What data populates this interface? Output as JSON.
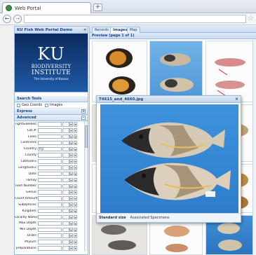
{
  "browser": {
    "tab_title": "Web Portal",
    "new_tab_label": "+",
    "back_label": "←",
    "forward_label": "→",
    "star_label": "☆"
  },
  "left_panel": {
    "title": "KU Fish Web Portal Demo",
    "collapse_label": "«",
    "logo": {
      "letters": "KU",
      "line1": "BIODIVERSITY",
      "line2": "INSTITUTE",
      "line3": "The University of Kansas"
    },
    "search_tools": {
      "title": "Search Tools",
      "geo_coords_label": "Geo Coords",
      "images_label": "Images"
    },
    "express": {
      "title": "Express",
      "toggle": "+"
    },
    "advanced": {
      "title": "Advanced",
      "toggle": "–"
    },
    "fields": [
      {
        "label": "rightSideRels:",
        "value": ""
      },
      {
        "label": "Cat #:",
        "value": ""
      },
      {
        "label": "Class:",
        "value": ""
      },
      {
        "label": "Continent:",
        "value": ""
      },
      {
        "label": "Country:",
        "value": "Fiji"
      },
      {
        "label": "County:",
        "value": ""
      },
      {
        "label": "Latitude1:",
        "value": ""
      },
      {
        "label": "Longitude1:",
        "value": ""
      },
      {
        "label": "Date:",
        "value": ""
      },
      {
        "label": "Family:",
        "value": ""
      },
      {
        "label": "Field Number:",
        "value": ""
      },
      {
        "label": "Genus:",
        "value": ""
      },
      {
        "label": "Count Amount:",
        "value": ""
      },
      {
        "label": "Subspecies:",
        "value": ""
      },
      {
        "label": "Kingdom:",
        "value": ""
      },
      {
        "label": "Locality Name:",
        "value": ""
      },
      {
        "label": "Max Depth:",
        "value": ""
      },
      {
        "label": "Min Depth:",
        "value": ""
      },
      {
        "label": "Order:",
        "value": ""
      },
      {
        "label": "Phylum:",
        "value": ""
      },
      {
        "label": "preparations:",
        "value": ""
      }
    ]
  },
  "right_panel": {
    "tabs": [
      {
        "label": "Records",
        "active": false
      },
      {
        "label": "Images",
        "active": true
      },
      {
        "label": "Map",
        "active": false
      }
    ],
    "preview_title": "Preview (page 1 of 1)"
  },
  "modal": {
    "title": "T4615_and_4660.jpg",
    "close_label": "×",
    "footer_tabs": [
      {
        "label": "Standard size",
        "active": true
      },
      {
        "label": "Associated Specimens",
        "active": false
      }
    ]
  },
  "colors": {
    "panel_border": "#99bbe8",
    "header_text": "#15428b",
    "logo_bg": "#0b2b5e",
    "photo_blue": "#3e93dc"
  }
}
